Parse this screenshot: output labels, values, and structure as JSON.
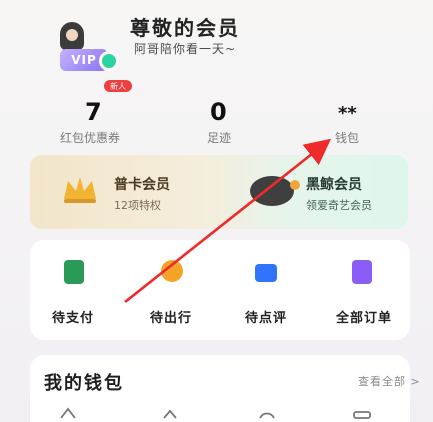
{
  "profile": {
    "title": "尊敬的会员",
    "subtitle": "阿哥陪你看一天~",
    "vip_mark": "VIP",
    "new_badge": "新人"
  },
  "stats": [
    {
      "value": "7",
      "label": "红包优惠券"
    },
    {
      "value": "0",
      "label": "足迹"
    },
    {
      "value": "**",
      "label": "钱包"
    }
  ],
  "membership": {
    "gold": {
      "title": "普卡会员",
      "subtitle": "12项特权"
    },
    "black": {
      "title": "黑鲸会员",
      "subtitle": "领爱奇艺会员"
    }
  },
  "services": [
    {
      "label": "待支付",
      "icon": "ticket-icon",
      "color": "#2a9a59"
    },
    {
      "label": "待出行",
      "icon": "clock-icon",
      "color": "#f4a326"
    },
    {
      "label": "待点评",
      "icon": "comment-icon",
      "color": "#2f73ff"
    },
    {
      "label": "全部订单",
      "icon": "orders-icon",
      "color": "#8b5cf6"
    }
  ],
  "favorites": {
    "title": "我的钱包",
    "link": "查看全部 >",
    "icons": [
      "wallet-icon",
      "coin-icon",
      "coupon-icon",
      "card-icon"
    ]
  },
  "annotation": {
    "arrow_color": "#ee2a2a"
  }
}
